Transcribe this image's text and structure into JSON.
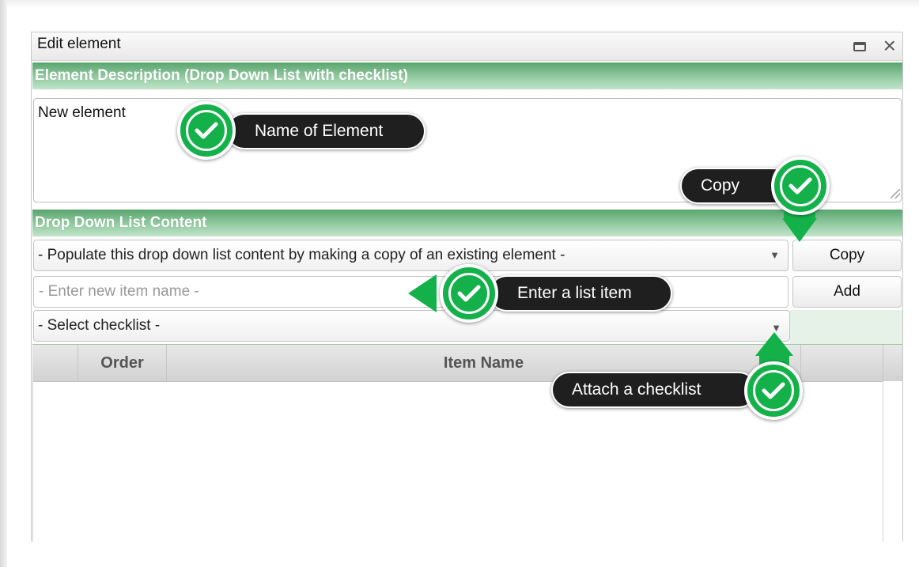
{
  "dialog": {
    "title": "Edit element"
  },
  "description_section": {
    "header": "Element Description (Drop Down List with checklist)",
    "value": "New element"
  },
  "list_section": {
    "header": "Drop Down List Content",
    "copy_select_value": "- Populate this drop down list content by making a copy of an existing element -",
    "copy_button": "Copy",
    "item_placeholder": "- Enter new item name -",
    "add_button": "Add",
    "checklist_select_value": "- Select checklist -"
  },
  "grid": {
    "columns": [
      "",
      "Order",
      "Item Name",
      ""
    ],
    "rows": []
  },
  "callouts": {
    "name": "Name of Element",
    "copy": "Copy",
    "list_item": "Enter a list item",
    "checklist": "Attach a checklist"
  },
  "icons": [
    "maximize-icon",
    "close-icon",
    "dropdown-caret-icon",
    "check-badge-icon"
  ],
  "colors": {
    "section_header": "#6fb582",
    "callout_badge": "#14b14a",
    "callout_bubble": "#1f1f1f"
  }
}
